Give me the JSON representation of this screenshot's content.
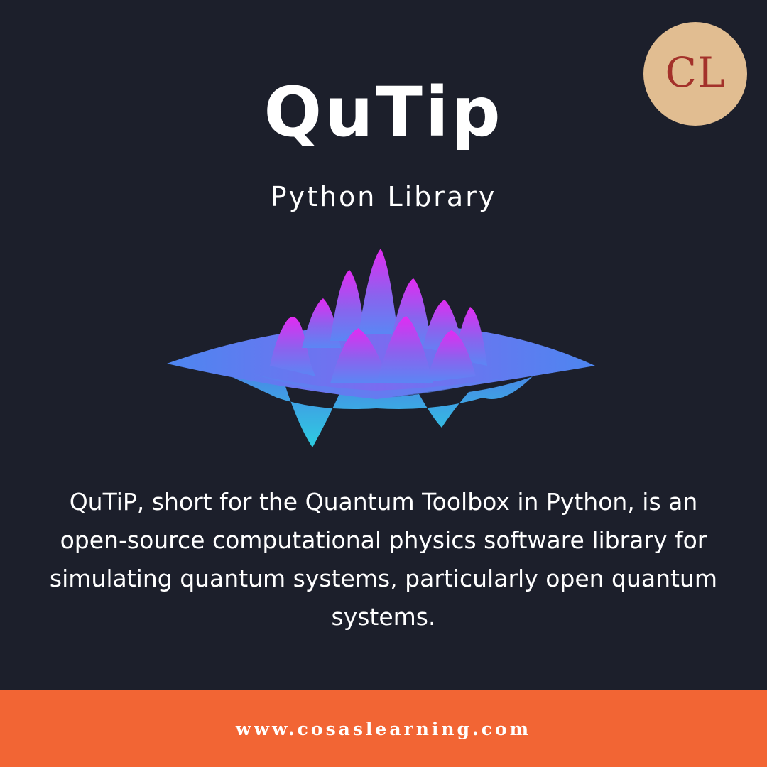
{
  "logo": {
    "text": "CL"
  },
  "title": "QuTip",
  "subtitle": "Python Library",
  "description": "QuTiP, short for the Quantum Toolbox in Python, is an open-source computational physics software library for simulating quantum systems, particularly open quantum systems.",
  "footer": {
    "url": "www.cosaslearning.com"
  },
  "colors": {
    "background": "#1c1f2b",
    "footer": "#f26534",
    "logo_circle": "#e1bd91",
    "logo_text": "#a3312a"
  },
  "illustration": "quantum-wave-surface"
}
